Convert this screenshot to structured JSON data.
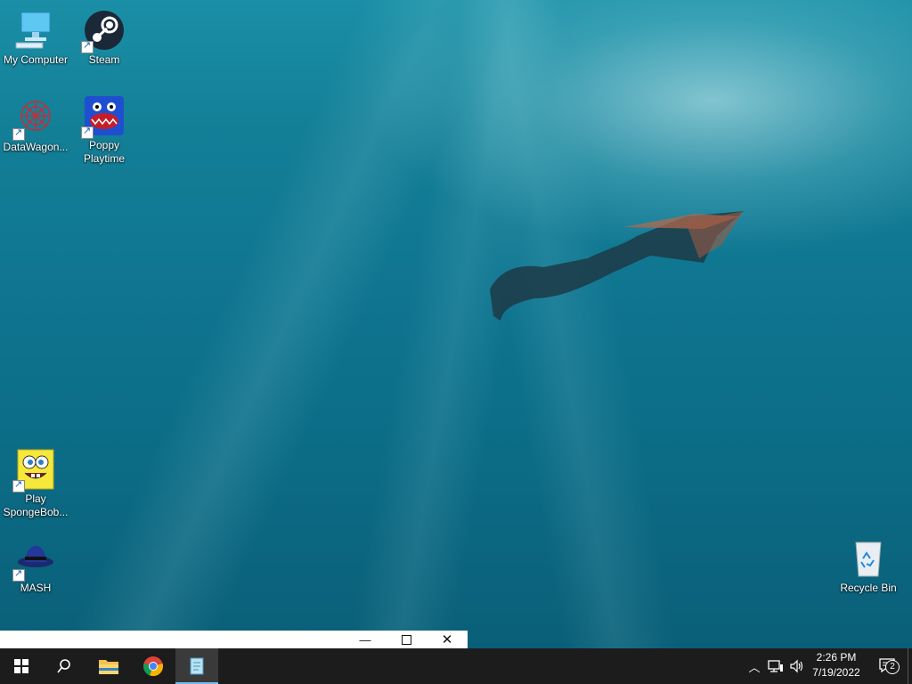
{
  "desktop": {
    "icons": [
      {
        "label": "My Computer"
      },
      {
        "label": "Steam"
      },
      {
        "label": "DataWagon..."
      },
      {
        "label": "Poppy\nPlaytime",
        "line1": "Poppy",
        "line2": "Playtime"
      },
      {
        "label": "Play SpongeBob...",
        "line1": "Play",
        "line2": "SpongeBob..."
      },
      {
        "label": "MASH"
      },
      {
        "label": "Recycle Bin"
      }
    ]
  },
  "taskbar": {
    "start_icon": "windows-logo-icon",
    "search_icon": "search-icon",
    "pinned": [
      "file-explorer-icon",
      "chrome-icon",
      "notepad-icon"
    ],
    "clock": {
      "time": "2:26 PM",
      "date": "7/19/2022"
    },
    "notifications_count": "2"
  },
  "window_strip": {
    "buttons": [
      "minimize-icon",
      "maximize-icon",
      "close-icon"
    ]
  }
}
